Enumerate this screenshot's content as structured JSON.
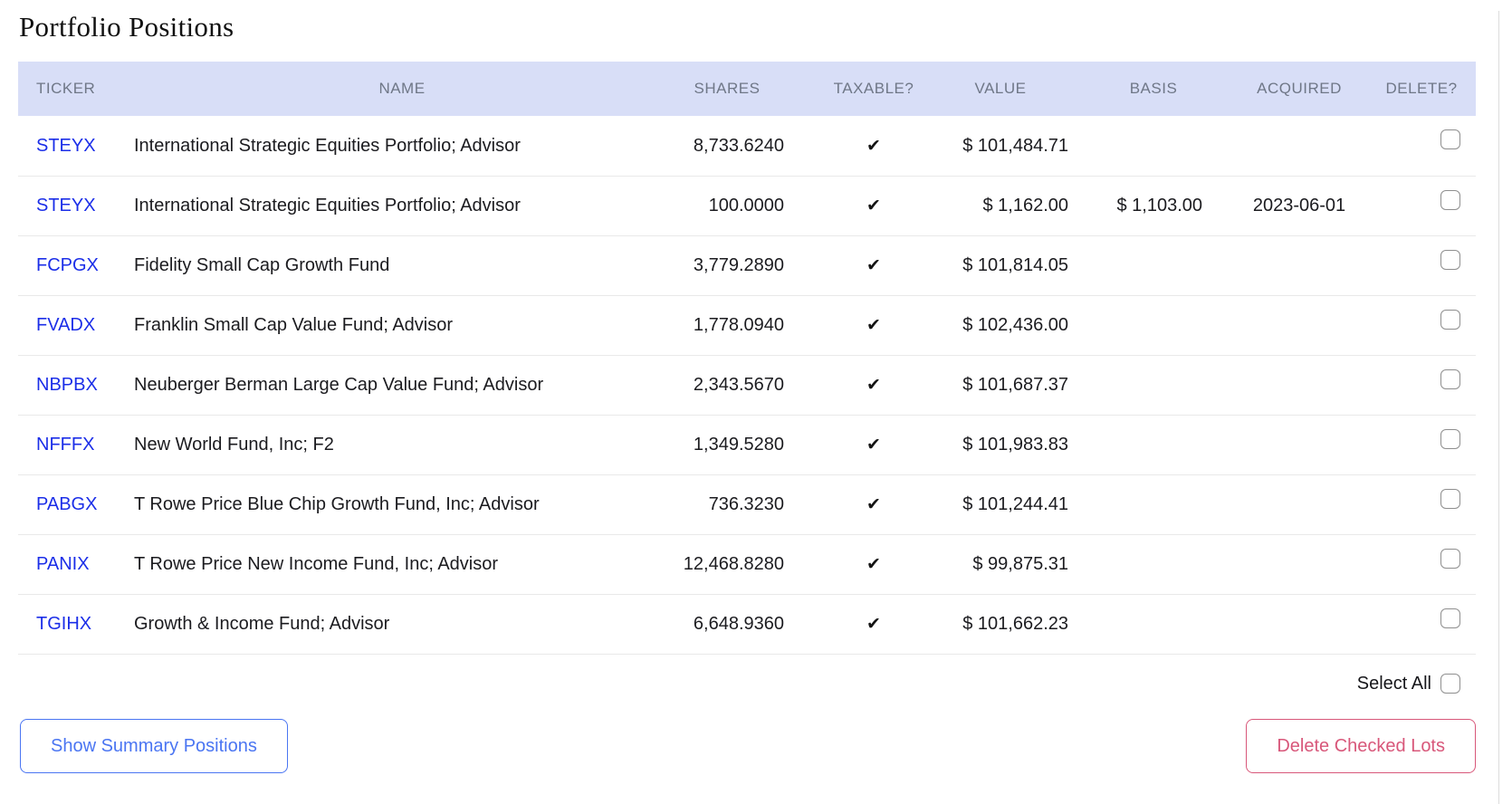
{
  "page": {
    "title": "Portfolio Positions"
  },
  "colors": {
    "header_background": "#d8def7",
    "header_text": "#6f7787",
    "ticker_link_blue": "#1b2ee8",
    "show_summary_blue": "#4a75f2",
    "delete_button_pink": "#d8577a",
    "row_divider": "#e9e9e9"
  },
  "table": {
    "columns": [
      {
        "key": "ticker",
        "label": "TICKER"
      },
      {
        "key": "name",
        "label": "NAME"
      },
      {
        "key": "shares",
        "label": "SHARES"
      },
      {
        "key": "taxable",
        "label": "TAXABLE?"
      },
      {
        "key": "value",
        "label": "VALUE"
      },
      {
        "key": "basis",
        "label": "BASIS"
      },
      {
        "key": "acquired",
        "label": "ACQUIRED"
      },
      {
        "key": "delete",
        "label": "DELETE?"
      }
    ],
    "rows": [
      {
        "ticker": "STEYX",
        "name": "International Strategic Equities Portfolio; Advisor",
        "shares": "8,733.6240",
        "taxable": "✔",
        "value": "$ 101,484.71",
        "basis": "",
        "acquired": ""
      },
      {
        "ticker": "STEYX",
        "name": "International Strategic Equities Portfolio; Advisor",
        "shares": "100.0000",
        "taxable": "✔",
        "value": "$ 1,162.00",
        "basis": "$ 1,103.00",
        "acquired": "2023-06-01"
      },
      {
        "ticker": "FCPGX",
        "name": "Fidelity Small Cap Growth Fund",
        "shares": "3,779.2890",
        "taxable": "✔",
        "value": "$ 101,814.05",
        "basis": "",
        "acquired": ""
      },
      {
        "ticker": "FVADX",
        "name": "Franklin Small Cap Value Fund; Advisor",
        "shares": "1,778.0940",
        "taxable": "✔",
        "value": "$ 102,436.00",
        "basis": "",
        "acquired": ""
      },
      {
        "ticker": "NBPBX",
        "name": "Neuberger Berman Large Cap Value Fund; Advisor",
        "shares": "2,343.5670",
        "taxable": "✔",
        "value": "$ 101,687.37",
        "basis": "",
        "acquired": ""
      },
      {
        "ticker": "NFFFX",
        "name": "New World Fund, Inc; F2",
        "shares": "1,349.5280",
        "taxable": "✔",
        "value": "$ 101,983.83",
        "basis": "",
        "acquired": ""
      },
      {
        "ticker": "PABGX",
        "name": "T Rowe Price Blue Chip Growth Fund, Inc; Advisor",
        "shares": "736.3230",
        "taxable": "✔",
        "value": "$ 101,244.41",
        "basis": "",
        "acquired": ""
      },
      {
        "ticker": "PANIX",
        "name": "T Rowe Price New Income Fund, Inc; Advisor",
        "shares": "12,468.8280",
        "taxable": "✔",
        "value": "$ 99,875.31",
        "basis": "",
        "acquired": ""
      },
      {
        "ticker": "TGIHX",
        "name": "Growth & Income Fund; Advisor",
        "shares": "6,648.9360",
        "taxable": "✔",
        "value": "$ 101,662.23",
        "basis": "",
        "acquired": ""
      }
    ],
    "select_all_label": "Select All"
  },
  "actions": {
    "show_summary_label": "Show Summary Positions",
    "delete_checked_label": "Delete Checked Lots"
  }
}
